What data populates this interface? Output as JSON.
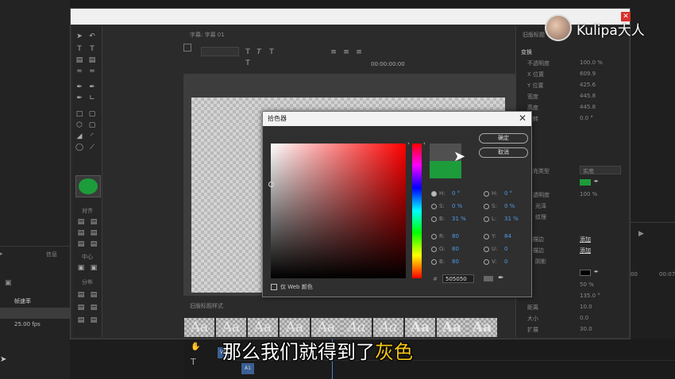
{
  "watermark": {
    "text": "Kulipa大人"
  },
  "left_panel": {
    "col1": "帧速率",
    "col2": "信息",
    "fps": "25.00 fps",
    "val": "0"
  },
  "designer": {
    "tab_label": "字幕: 字幕 01",
    "timecode": "00:00:00:00",
    "tools_sections": {
      "align": "对齐",
      "center": "中心",
      "distribute": "分布"
    },
    "styles_label": "旧版标题样式",
    "style_samples": [
      "Aa",
      "Aa",
      "Aa",
      "Aa",
      "Aa",
      "Aa",
      "Aa",
      "Aa",
      "Aa",
      "Aa"
    ]
  },
  "properties": {
    "header": "旧版标题",
    "section_transform": "变换",
    "rows": [
      {
        "label": "不透明度",
        "value": "100.0 %"
      },
      {
        "label": "X 位置",
        "value": "609.9"
      },
      {
        "label": "Y 位置",
        "value": "425.6"
      },
      {
        "label": "宽度",
        "value": "445.8"
      },
      {
        "label": "高度",
        "value": "445.8"
      },
      {
        "label": "旋转",
        "value": "0.0 °"
      }
    ],
    "fill_type_label": "填充类型",
    "fill_type_value": "实底",
    "fill_opacity_label": "不透明度",
    "fill_opacity_value": "100 %",
    "gloss": "光泽",
    "texture": "纹理",
    "stroke": "描边",
    "inner_stroke": "内描边",
    "outer_stroke": "外描边",
    "add": "添加",
    "shadow": "阴影",
    "shadow_opacity": "50 %",
    "shadow_angle": "135.0 °",
    "distance": "10.0",
    "size": "0.0",
    "spread": "30.0",
    "distance_label": "距离",
    "size_label": "大小",
    "spread_label": "扩展"
  },
  "picker": {
    "title": "拾色器",
    "ok": "确定",
    "cancel": "取消",
    "hsb": [
      {
        "k": "H:",
        "v": "0 °"
      },
      {
        "k": "S:",
        "v": "0 %"
      },
      {
        "k": "B:",
        "v": "31 %"
      }
    ],
    "rgb": [
      {
        "k": "R:",
        "v": "80"
      },
      {
        "k": "G:",
        "v": "80"
      },
      {
        "k": "B:",
        "v": "80"
      }
    ],
    "hsl": [
      {
        "k": "H:",
        "v": "0 °"
      },
      {
        "k": "S:",
        "v": "0 %"
      },
      {
        "k": "L:",
        "v": "31 %"
      }
    ],
    "yuv": [
      {
        "k": "Y:",
        "v": "84"
      },
      {
        "k": "U:",
        "v": "0"
      },
      {
        "k": "V:",
        "v": "0"
      }
    ],
    "hex_prefix": "#",
    "hex": "505050",
    "web_only": "仅 Web 颜色",
    "new_color": "#505050",
    "old_color": "#1d9c3b"
  },
  "timeline": {
    "v1": "V1",
    "a1": "A1",
    "time_right": "00:07",
    "time_mid": "00"
  },
  "subtitle": {
    "prefix": "那么我们就得到了",
    "highlight": "灰色"
  }
}
